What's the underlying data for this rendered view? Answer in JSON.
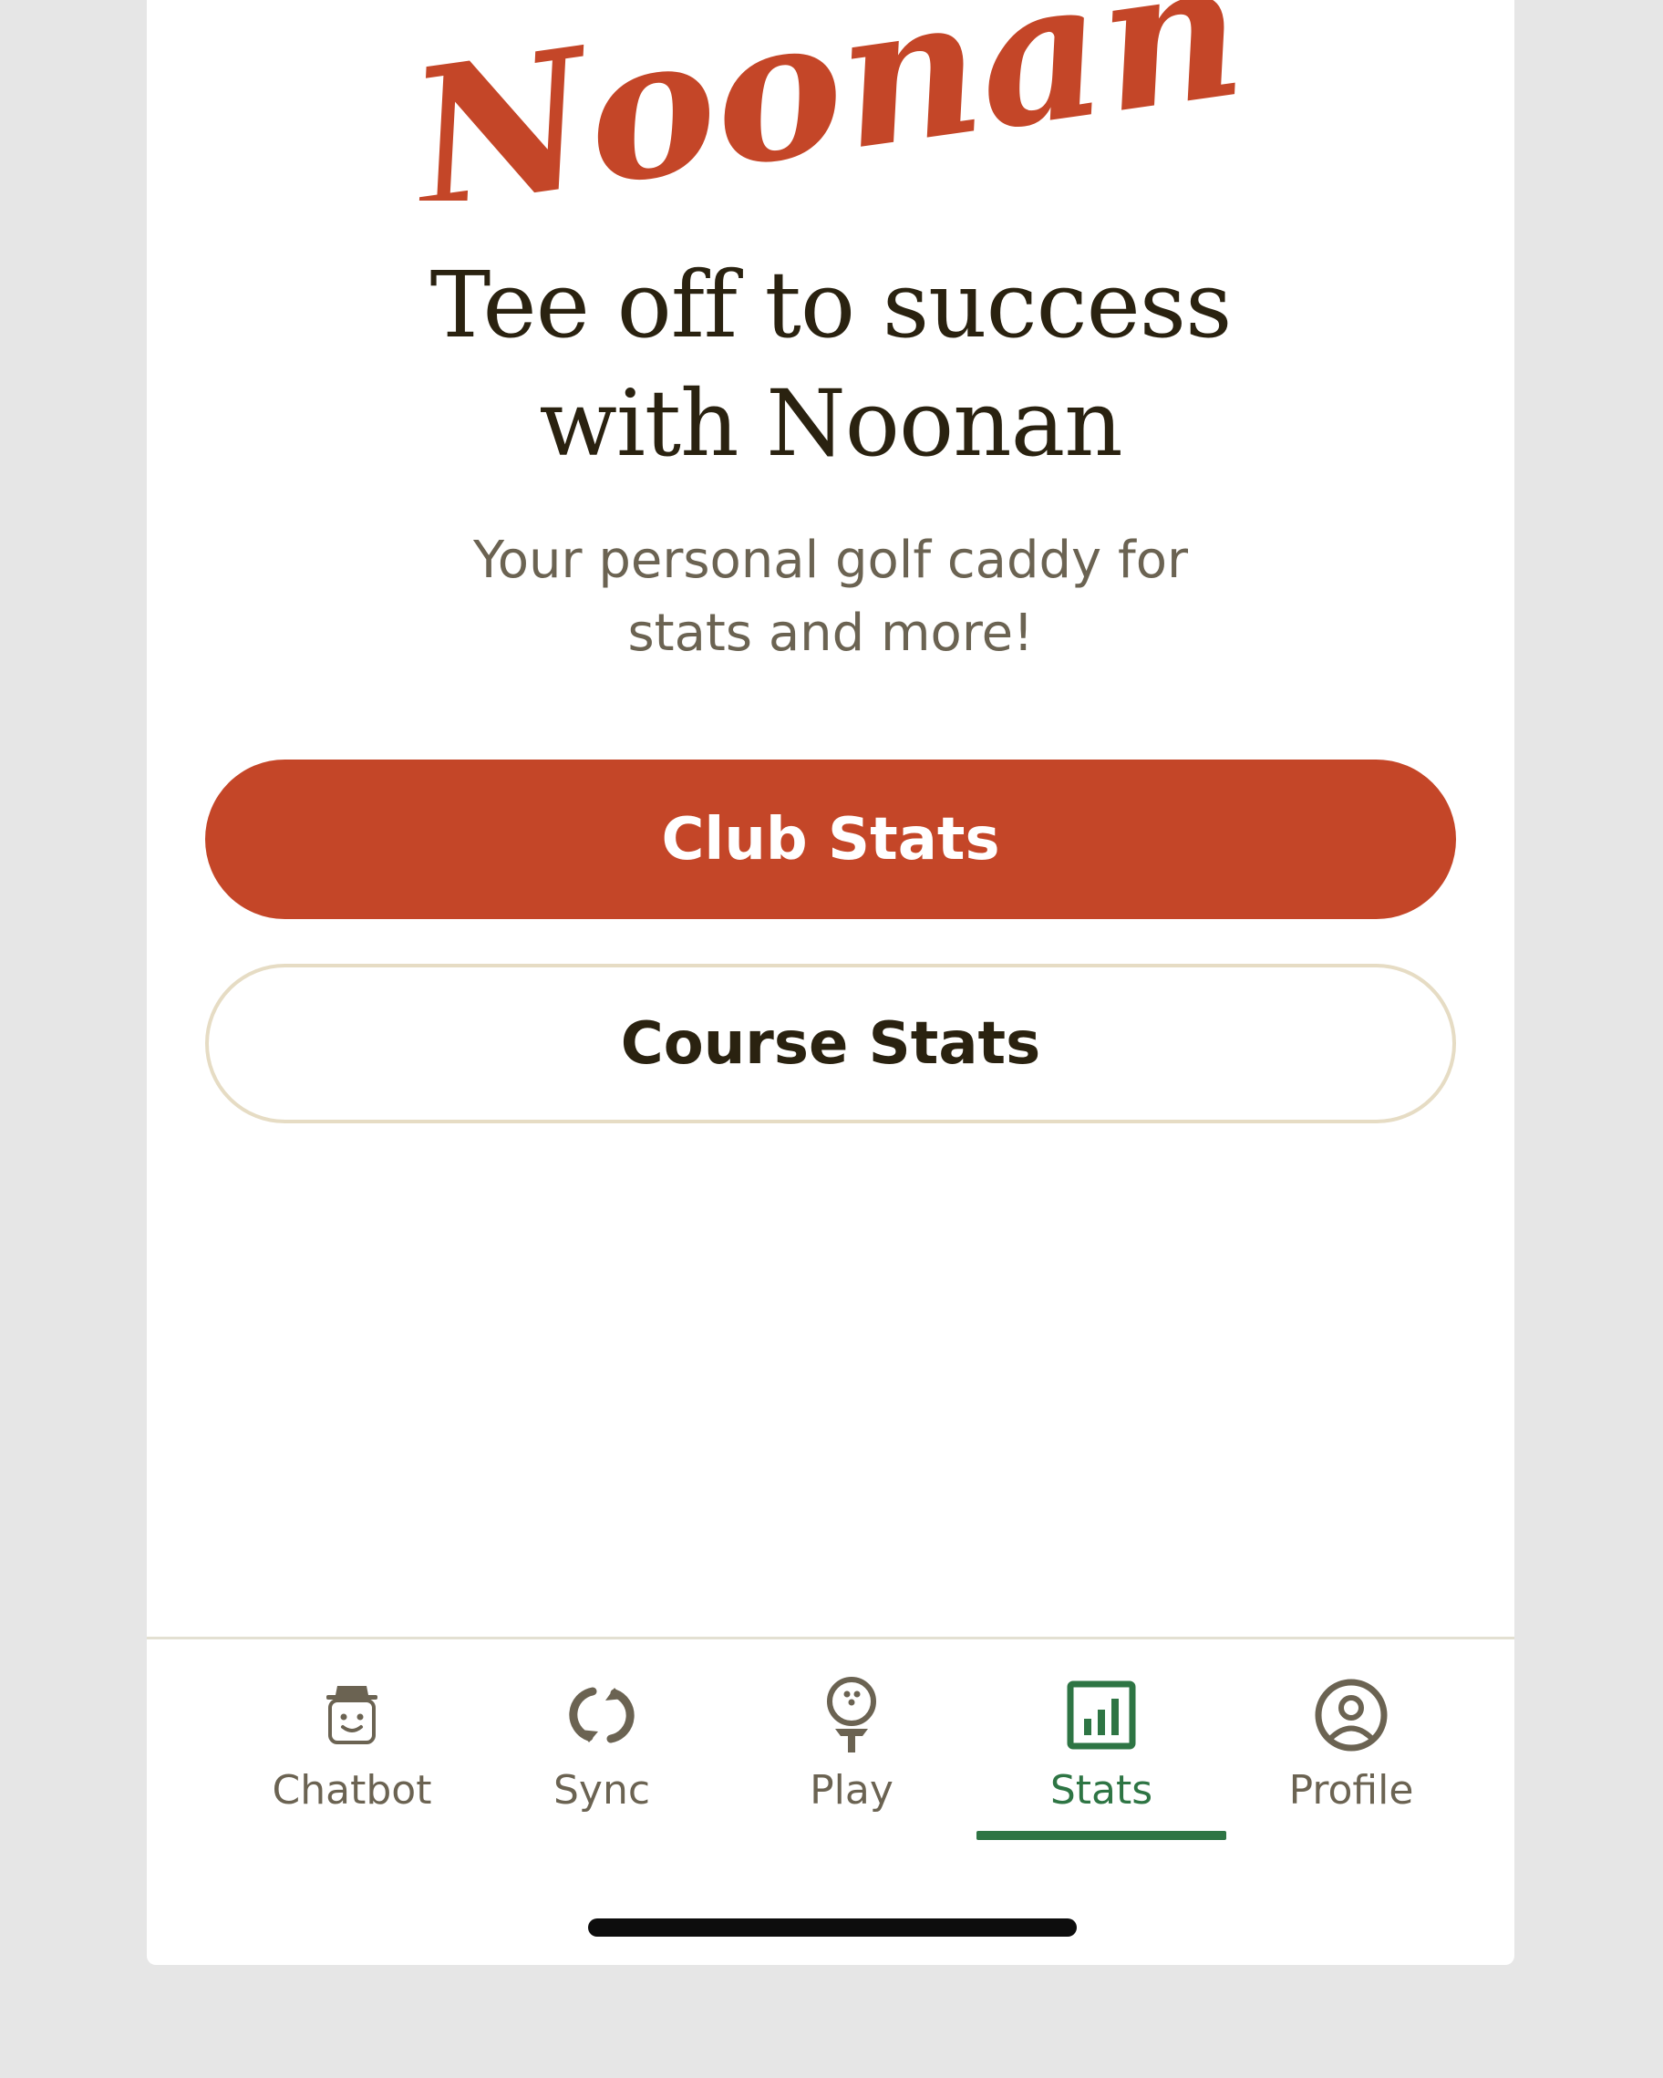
{
  "brand": {
    "logo_text": "Noonan",
    "logo_color": "#c44628"
  },
  "hero": {
    "headline_line1": "Tee off to success",
    "headline_line2": "with Noonan",
    "subtitle_line1": "Your personal golf caddy for",
    "subtitle_line2": "stats and more!"
  },
  "actions": {
    "primary_label": "Club Stats",
    "secondary_label": "Course Stats"
  },
  "tabbar": {
    "active": "Stats",
    "active_color": "#2e7544",
    "items": [
      {
        "label": "Chatbot",
        "icon": "caddy-face-icon"
      },
      {
        "label": "Sync",
        "icon": "sync-icon"
      },
      {
        "label": "Play",
        "icon": "golf-ball-tee-icon"
      },
      {
        "label": "Stats",
        "icon": "bar-chart-icon"
      },
      {
        "label": "Profile",
        "icon": "user-circle-icon"
      }
    ]
  }
}
